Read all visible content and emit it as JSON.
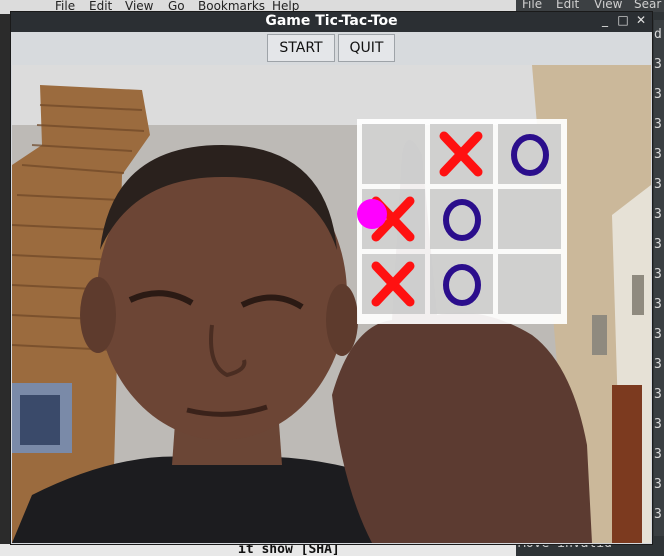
{
  "background": {
    "left_menu": [
      "File",
      "Edit",
      "View",
      "Go",
      "Bookmarks",
      "Help"
    ],
    "right_menu": [
      "File",
      "Edit",
      "View",
      "Sear"
    ],
    "right_col_text": [
      "d",
      "3",
      "3",
      "3",
      "3",
      "3",
      "3",
      "3",
      "3",
      "3",
      "3",
      "3",
      "3",
      "3",
      "3",
      "3",
      "3",
      "3"
    ],
    "bottom_left_text": "it show [SHA]",
    "bottom_right_text": "Move invalid"
  },
  "window": {
    "title": "Game Tic-Tac-Toe",
    "controls": [
      "minimize-icon",
      "maximize-icon",
      "close-icon"
    ],
    "controls_glyphs": [
      "_",
      "□",
      "✕"
    ]
  },
  "toolbar": {
    "start_label": "START",
    "quit_label": "QUIT"
  },
  "game": {
    "board": [
      [
        "",
        "X",
        "O"
      ],
      [
        "X",
        "O",
        ""
      ],
      [
        "X",
        "O",
        ""
      ]
    ],
    "x_color": "#ff1111",
    "o_color": "#2b0e8c",
    "cursor_color": "#ff00ff"
  }
}
